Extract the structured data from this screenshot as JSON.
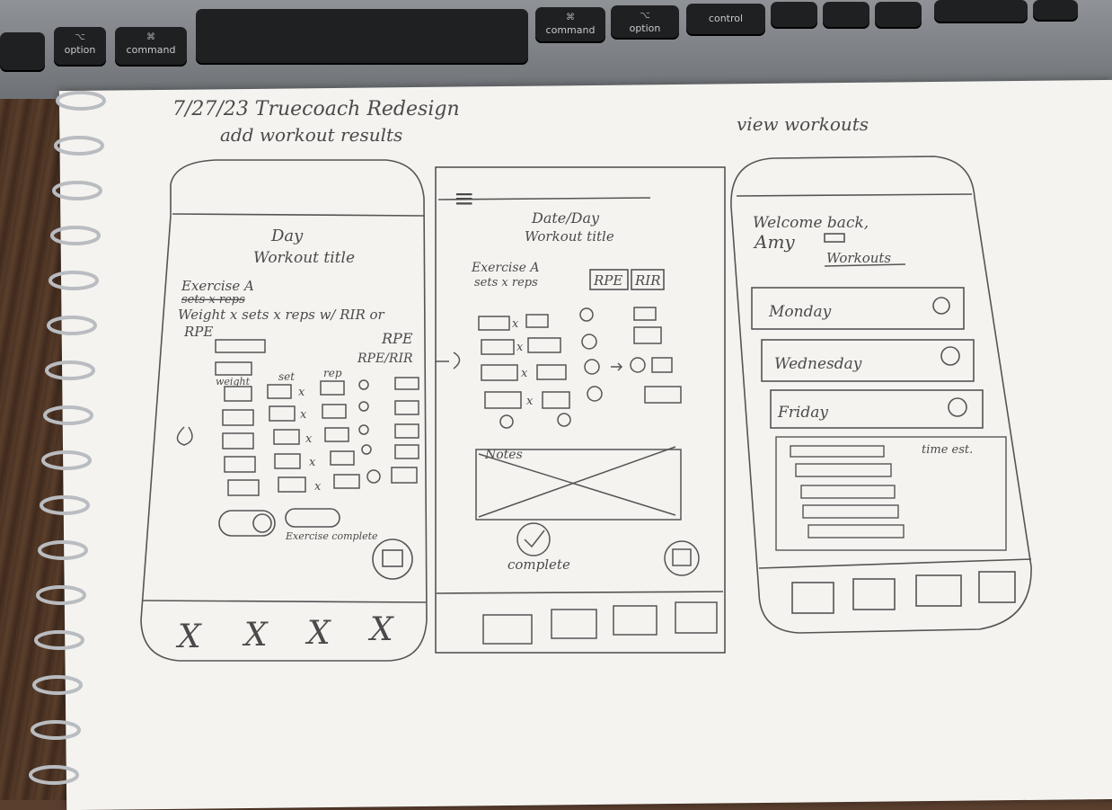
{
  "keyboard": {
    "keys": [
      {
        "sym": "⌥",
        "label": "option"
      },
      {
        "sym": "⌘",
        "label": "command"
      },
      {
        "sym": "⌘",
        "label": "command"
      },
      {
        "sym": "⌥",
        "label": "option"
      },
      {
        "sym": "",
        "label": "control"
      }
    ]
  },
  "header": {
    "date_title": "7/27/23  Truecoach Redesign",
    "subtitle": "add workout results",
    "right_title": "view workouts"
  },
  "screen1": {
    "day": "Day",
    "workout_title": "Workout title",
    "exercise": "Exercise A",
    "sets_reps_struck": "sets x reps",
    "weight_line": "Weight x sets x reps  w/ RIR or",
    "rpe_left": "RPE",
    "rpe_right": "RPE",
    "rpe_rir": "RPE/RIR",
    "col_weight": "weight",
    "col_set": "set",
    "col_rep": "rep",
    "x": "x",
    "exercise_complete": "Exercise complete",
    "nav": [
      "X",
      "X",
      "X",
      "X"
    ]
  },
  "screen2": {
    "menu_icon": "≡",
    "date_day": "Date/Day",
    "workout_title": "Workout title",
    "exercise": "Exercise A",
    "sets_reps": "sets x reps",
    "rpe": "RPE",
    "rir": "RIR",
    "x": "x",
    "notes": "Notes",
    "complete": "complete"
  },
  "screen3": {
    "welcome": "Welcome back,",
    "name": "Amy",
    "workouts_heading": "Workouts",
    "days": [
      "Monday",
      "Wednesday",
      "Friday"
    ],
    "time_est": "time est."
  }
}
